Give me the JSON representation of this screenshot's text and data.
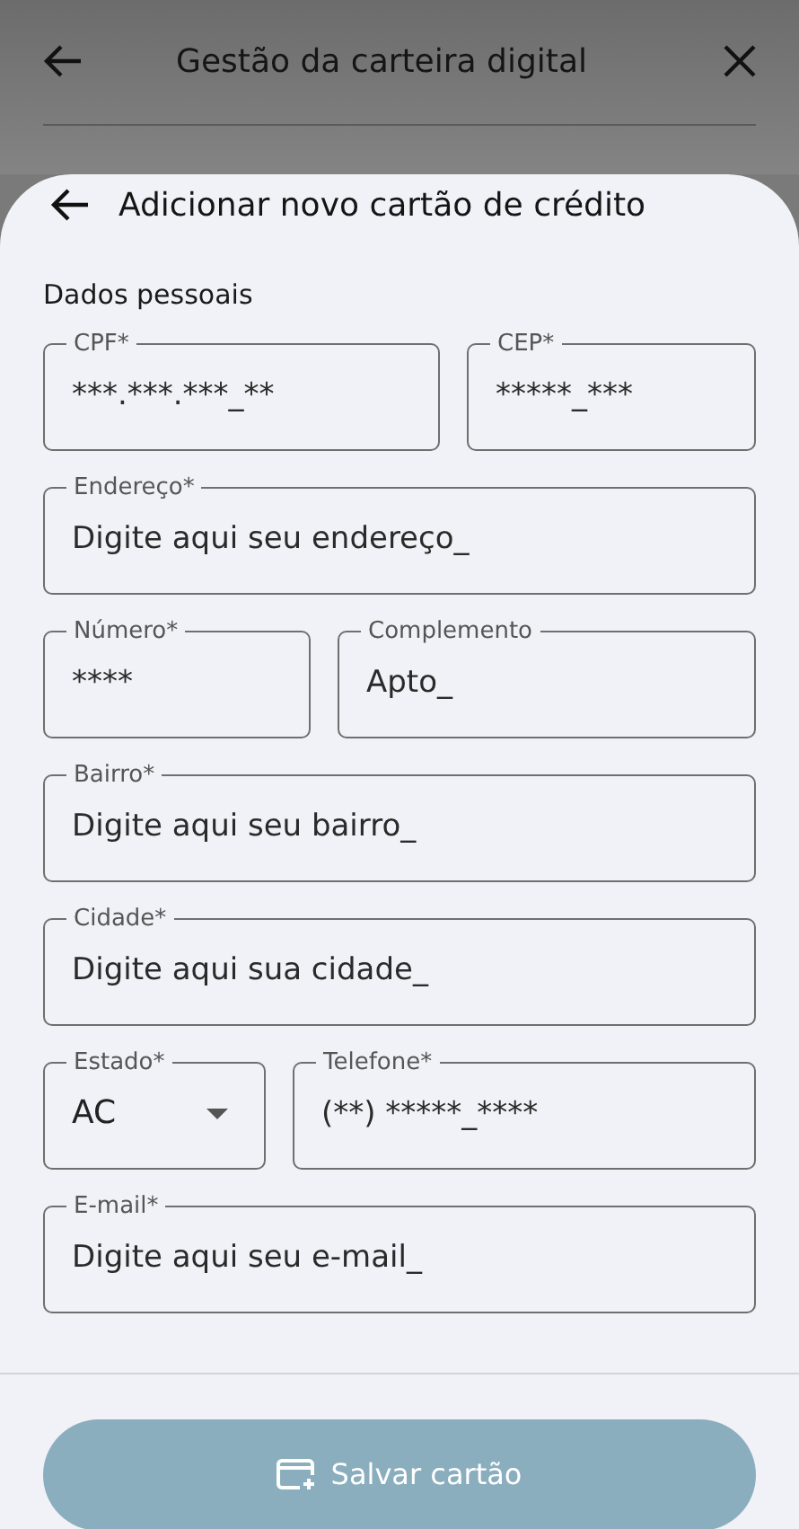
{
  "app_bar": {
    "title": "Gestão da carteira digital"
  },
  "sheet": {
    "title": "Adicionar novo cartão de crédito",
    "section": "Dados pessoais",
    "rows": [
      {
        "fields": [
          {
            "kind": "text",
            "label": "CPF*",
            "placeholder": "***.***.***_**"
          },
          {
            "kind": "text",
            "label": "CEP*",
            "placeholder": "*****_***"
          }
        ]
      },
      {
        "fields": [
          {
            "kind": "text",
            "label": "Endereço*",
            "placeholder": "Digite aqui seu endereço_"
          }
        ]
      },
      {
        "fields": [
          {
            "kind": "text",
            "label": "Número*",
            "placeholder": "****"
          },
          {
            "kind": "text",
            "label": "Complemento",
            "placeholder": "Apto_"
          }
        ]
      },
      {
        "fields": [
          {
            "kind": "text",
            "label": "Bairro*",
            "placeholder": "Digite aqui seu bairro_"
          }
        ]
      },
      {
        "fields": [
          {
            "kind": "text",
            "label": "Cidade*",
            "placeholder": "Digite aqui sua cidade_"
          }
        ]
      },
      {
        "fields": [
          {
            "kind": "select",
            "label": "Estado*",
            "value": "AC"
          },
          {
            "kind": "text",
            "label": "Telefone*",
            "placeholder": "(**) *****_****"
          }
        ]
      },
      {
        "fields": [
          {
            "kind": "text",
            "label": "E-mail*",
            "placeholder": "Digite aqui seu e-mail_"
          }
        ]
      }
    ],
    "save_button": {
      "label": "Salvar cartão"
    }
  }
}
